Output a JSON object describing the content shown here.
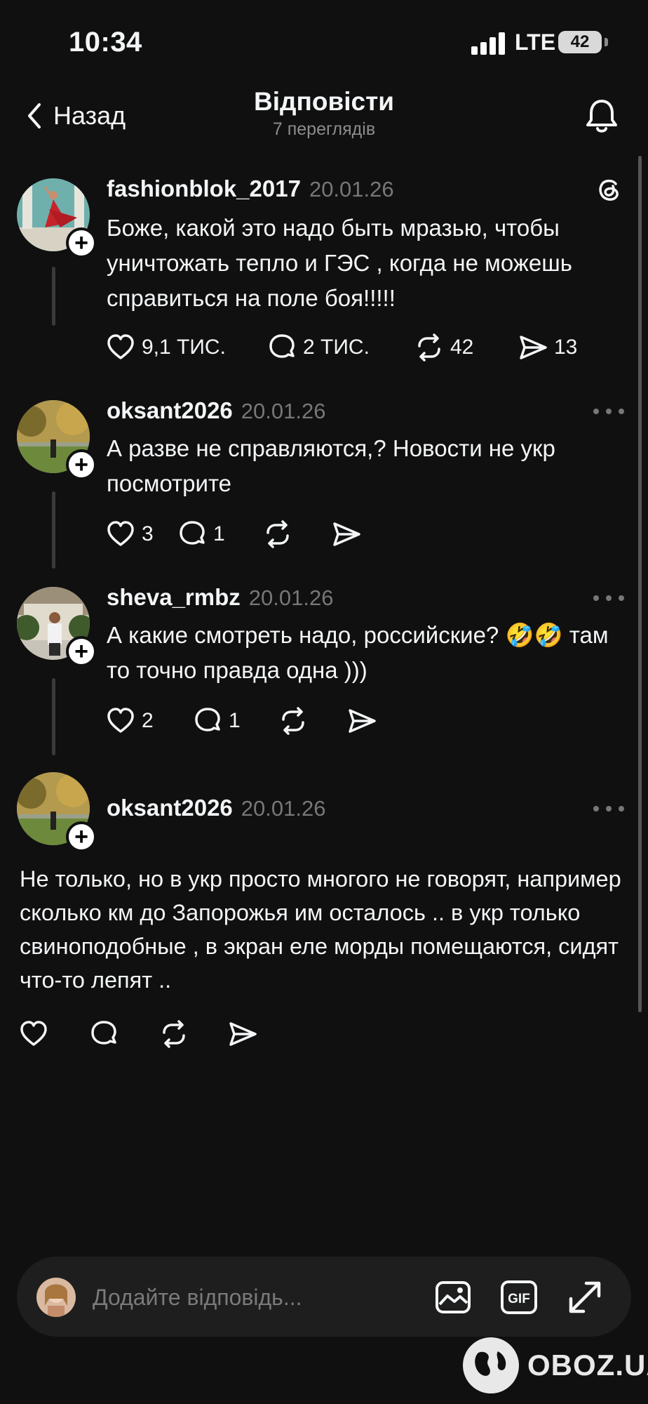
{
  "status_bar": {
    "time": "10:34",
    "network": "LTE",
    "battery": "42"
  },
  "header": {
    "back_label": "Назад",
    "title": "Відповісти",
    "subtitle": "7 переглядів"
  },
  "posts": [
    {
      "username": "fashionblok_2017",
      "date": "20.01.26",
      "text": "Боже, какой это надо быть мразью, чтобы уничтожать тепло и ГЭС , когда не можешь справиться на поле боя!!!!!",
      "likes": "9,1 ТИС.",
      "replies": "2 ТИС.",
      "reposts": "42",
      "shares": "13",
      "top_icon": "threads-icon"
    },
    {
      "username": "oksant2026",
      "date": "20.01.26",
      "text": "А разве не справляются,? Новости не укр посмотрите",
      "likes": "3",
      "replies": "1",
      "reposts": "",
      "shares": ""
    },
    {
      "username": "sheva_rmbz",
      "date": "20.01.26",
      "text": "А какие смотреть надо, российские? 🤣🤣 там то точно правда одна )))",
      "likes": "2",
      "replies": "1",
      "reposts": "",
      "shares": ""
    },
    {
      "username": "oksant2026",
      "date": "20.01.26",
      "text": "Не только, но в укр просто многого не говорят, например сколько км до Запорожья им осталось .. в укр только свиноподобные , в экран еле морды помещаются,  сидят что-то лепят ..",
      "likes": "",
      "replies": "",
      "reposts": "",
      "shares": ""
    }
  ],
  "reply_bar": {
    "placeholder": "Додайте відповідь..."
  },
  "watermark": {
    "text": "OBOZ.UA"
  },
  "colors": {
    "background": "#101010",
    "text": "#f3f5f7",
    "muted": "#777777",
    "input_bg": "#1e1e1e"
  }
}
